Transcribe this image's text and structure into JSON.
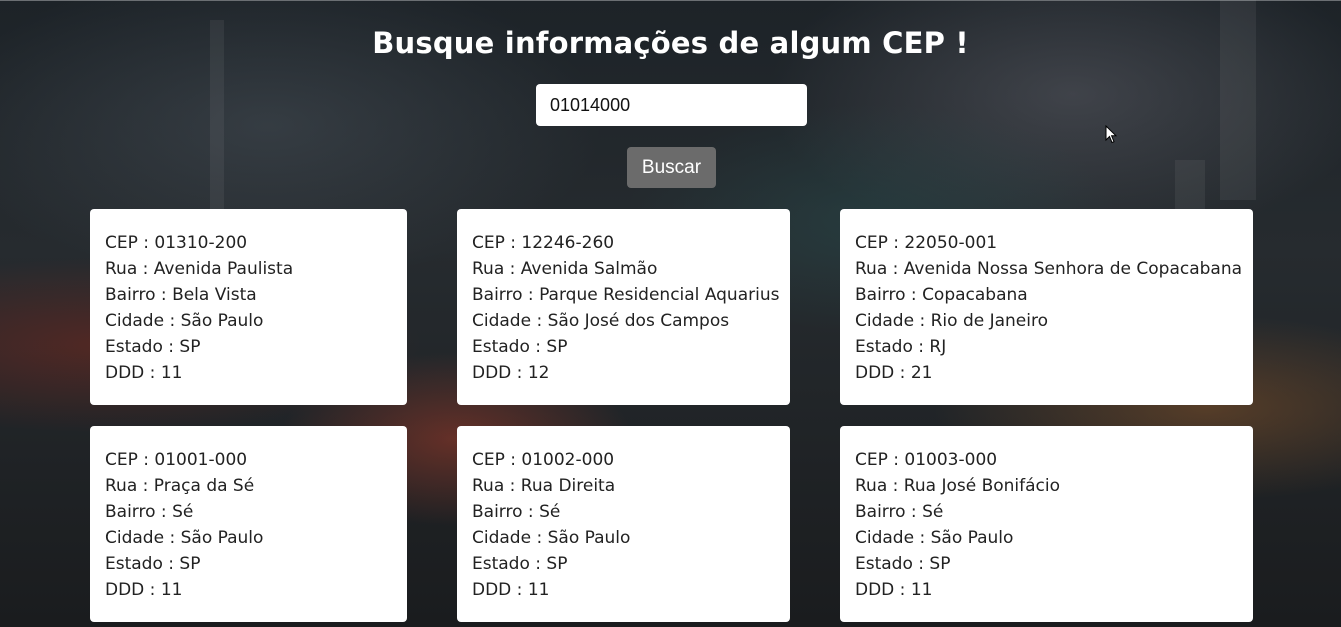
{
  "header": {
    "title": "Busque informações de algum CEP !"
  },
  "search": {
    "value": "01014000",
    "button_label": "Buscar"
  },
  "field_labels": {
    "cep": "CEP",
    "rua": "Rua",
    "bairro": "Bairro",
    "cidade": "Cidade",
    "estado": "Estado",
    "ddd": "DDD"
  },
  "separator": " : ",
  "results": [
    {
      "cep": "01310-200",
      "rua": "Avenida Paulista",
      "bairro": "Bela Vista",
      "cidade": "São Paulo",
      "estado": "SP",
      "ddd": "11"
    },
    {
      "cep": "12246-260",
      "rua": "Avenida Salmão",
      "bairro": "Parque Residencial Aquarius",
      "cidade": "São José dos Campos",
      "estado": "SP",
      "ddd": "12"
    },
    {
      "cep": "22050-001",
      "rua": "Avenida Nossa Senhora de Copacabana",
      "bairro": "Copacabana",
      "cidade": "Rio de Janeiro",
      "estado": "RJ",
      "ddd": "21"
    },
    {
      "cep": "01001-000",
      "rua": "Praça da Sé",
      "bairro": "Sé",
      "cidade": "São Paulo",
      "estado": "SP",
      "ddd": "11"
    },
    {
      "cep": "01002-000",
      "rua": "Rua Direita",
      "bairro": "Sé",
      "cidade": "São Paulo",
      "estado": "SP",
      "ddd": "11"
    },
    {
      "cep": "01003-000",
      "rua": "Rua José Bonifácio",
      "bairro": "Sé",
      "cidade": "São Paulo",
      "estado": "SP",
      "ddd": "11"
    }
  ],
  "colors": {
    "button_bg": "#6b6b6b",
    "card_bg": "#ffffff",
    "title_text": "#ffffff"
  }
}
